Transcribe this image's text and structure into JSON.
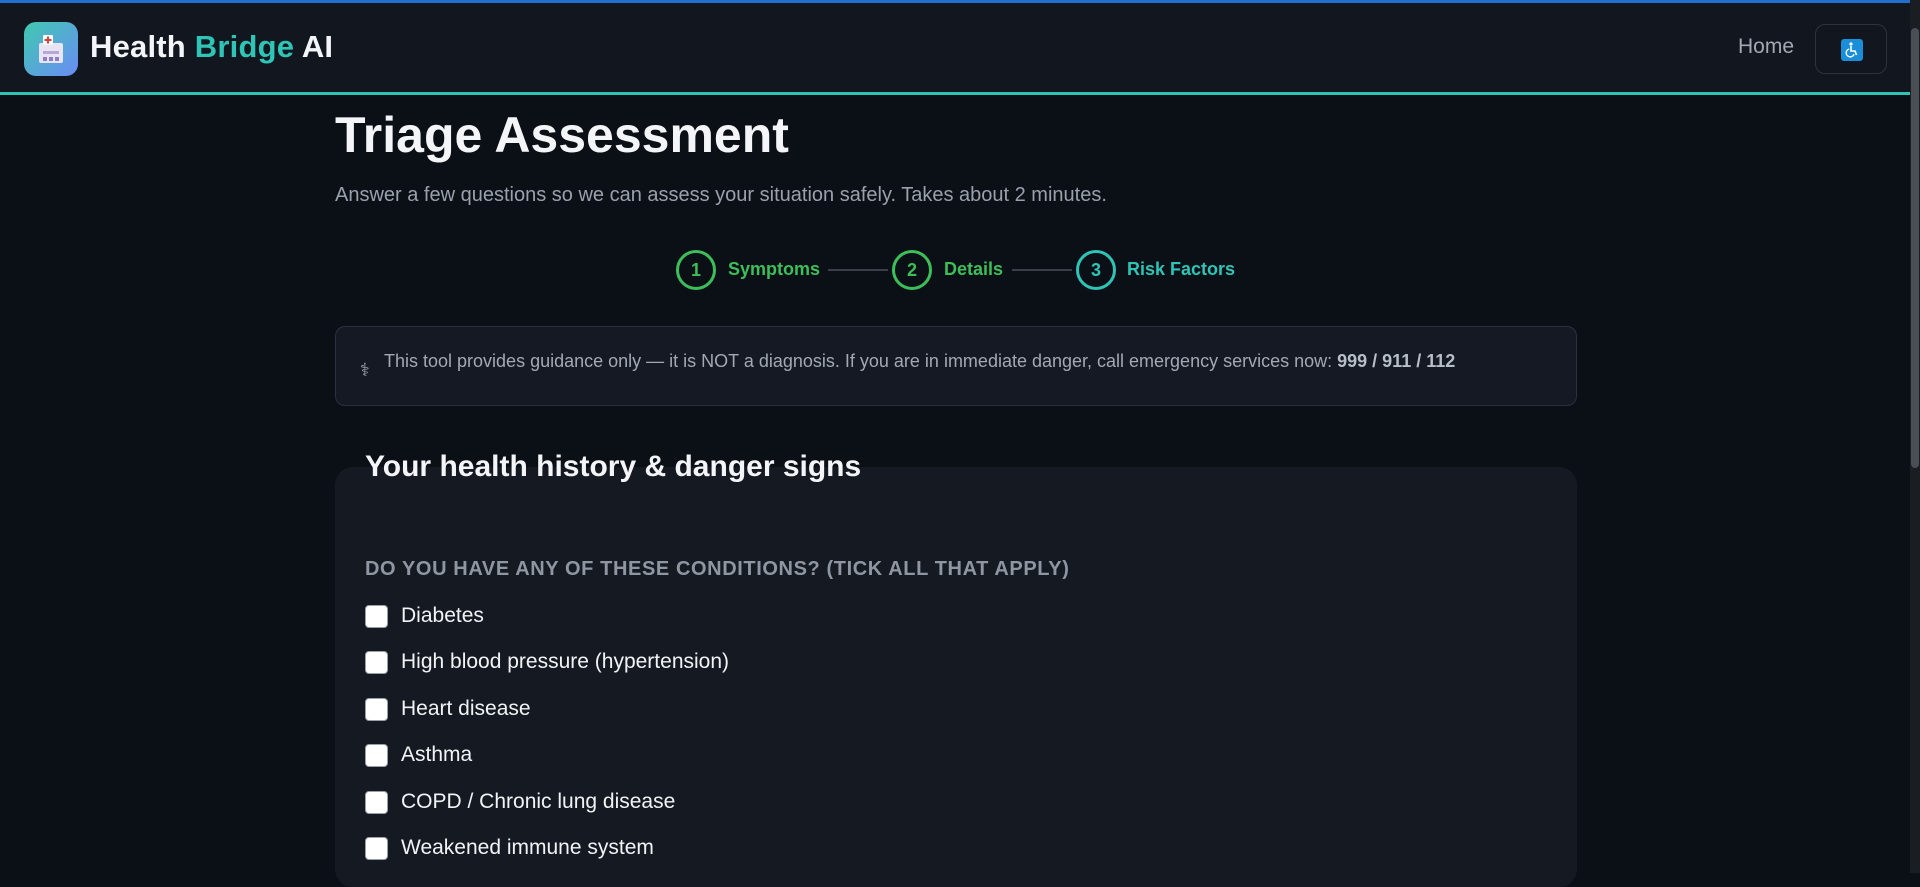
{
  "header": {
    "brand_part1": "Health",
    "brand_part2": "Bridge",
    "brand_part3": "AI",
    "logo_icon": "hospital-icon",
    "nav_home": "Home",
    "accessibility_icon": "wheelchair-icon"
  },
  "page": {
    "title": "Triage Assessment",
    "subtitle": "Answer a few questions so we can assess your situation safely. Takes about 2 minutes."
  },
  "stepper": {
    "steps": [
      {
        "number": "1",
        "label": "Symptoms",
        "state": "complete"
      },
      {
        "number": "2",
        "label": "Details",
        "state": "complete"
      },
      {
        "number": "3",
        "label": "Risk Factors",
        "state": "active"
      }
    ]
  },
  "notice": {
    "icon": "caduceus-icon",
    "text": "This tool provides guidance only — it is NOT a diagnosis. If you are in immediate danger, call emergency services now:",
    "numbers": "999 / 911 / 112"
  },
  "card": {
    "title": "Your health history & danger signs",
    "question": "Do you have any of these conditions? (Tick all that apply)",
    "conditions": [
      {
        "label": "Diabetes",
        "checked": false
      },
      {
        "label": "High blood pressure (hypertension)",
        "checked": false
      },
      {
        "label": "Heart disease",
        "checked": false
      },
      {
        "label": "Asthma",
        "checked": false
      },
      {
        "label": "COPD / Chronic lung disease",
        "checked": false
      },
      {
        "label": "Weakened immune system",
        "checked": false
      }
    ]
  },
  "colors": {
    "accent_teal": "#2ec4b6",
    "step_complete_green": "#3cbf5a",
    "background": "#0b0f16",
    "panel": "#151a22"
  }
}
